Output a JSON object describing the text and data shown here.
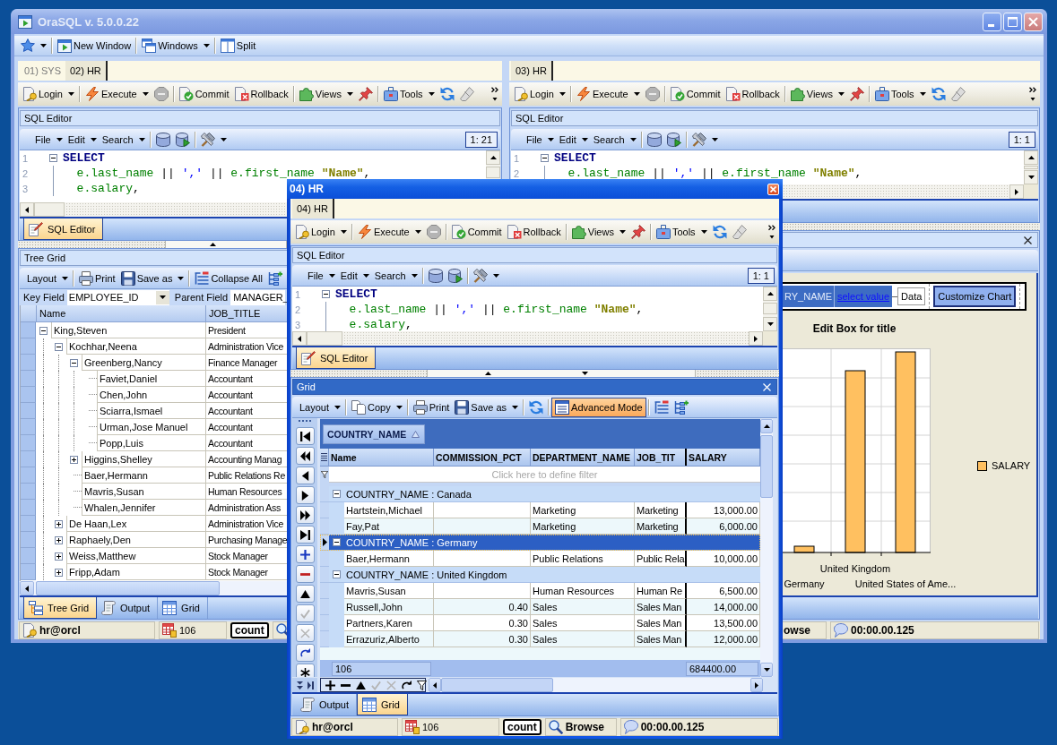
{
  "main_window": {
    "title": "OraSQL v. 5.0.0.22",
    "toolbar": [
      {
        "kind": "icon-menu"
      },
      {
        "kind": "separator"
      },
      {
        "kind": "button",
        "label": "New Window"
      },
      {
        "kind": "separator"
      },
      {
        "kind": "menu",
        "label": "Windows"
      },
      {
        "kind": "separator"
      },
      {
        "kind": "button",
        "label": "Split"
      }
    ],
    "panes": [
      {
        "tabs": [
          {
            "label": "01) SYS",
            "selected": false
          },
          {
            "label": "02) HR",
            "selected": true
          }
        ],
        "toolbar": [
          {
            "kind": "menu",
            "label": "Login"
          },
          {
            "kind": "separator"
          },
          {
            "kind": "menu",
            "label": "Execute"
          },
          {
            "kind": "icon"
          },
          {
            "kind": "separator"
          },
          {
            "kind": "button",
            "label": "Commit"
          },
          {
            "kind": "button",
            "label": "Rollback"
          },
          {
            "kind": "separator"
          },
          {
            "kind": "menu",
            "label": "Views"
          },
          {
            "kind": "icon"
          },
          {
            "kind": "separator"
          },
          {
            "kind": "menu",
            "label": "Tools"
          },
          {
            "kind": "icon"
          },
          {
            "kind": "icon"
          },
          {
            "kind": "overflow"
          }
        ],
        "editor": {
          "title": "SQL Editor",
          "toolbar": [
            {
              "kind": "menu",
              "label": "File"
            },
            {
              "kind": "menu",
              "label": "Edit"
            },
            {
              "kind": "menu",
              "label": "Search"
            },
            {
              "kind": "separator"
            },
            {
              "kind": "icon"
            },
            {
              "kind": "icon"
            },
            {
              "kind": "separator"
            },
            {
              "kind": "icon-menu"
            }
          ],
          "position": "1: 21",
          "lines": [
            {
              "number": "1",
              "fold": true,
              "indented": false,
              "tokens": [
                {
                  "kind": "keyword",
                  "text": "SELECT"
                }
              ]
            },
            {
              "number": "2",
              "fold": false,
              "indented": true,
              "tokens": [
                {
                  "kind": "ident",
                  "text": "e.last_name"
                },
                {
                  "kind": "op",
                  "text": "||"
                },
                {
                  "kind": "string",
                  "text": "','"
                },
                {
                  "kind": "op",
                  "text": "||"
                },
                {
                  "kind": "ident",
                  "text": "e.first_name"
                },
                {
                  "kind": "alias",
                  "text": "\"Name\""
                },
                {
                  "kind": "punct",
                  "text": ","
                }
              ]
            },
            {
              "number": "3",
              "fold": false,
              "indented": true,
              "tokens": [
                {
                  "kind": "ident",
                  "text": "e.salary"
                },
                {
                  "kind": "punct",
                  "text": ","
                }
              ]
            }
          ],
          "tabs": [
            {
              "label": "SQL Editor",
              "selected": true
            }
          ]
        },
        "tree_grid": {
          "title": "Tree Grid",
          "toolbar": [
            {
              "kind": "menu",
              "label": "Layout"
            },
            {
              "kind": "separator"
            },
            {
              "kind": "button",
              "label": "Print"
            },
            {
              "kind": "menu",
              "label": "Save as"
            },
            {
              "kind": "separator"
            },
            {
              "kind": "button",
              "label": "Collapse All"
            },
            {
              "kind": "icon"
            }
          ],
          "key_field": {
            "label": "Key Field",
            "value": "EMPLOYEE_ID"
          },
          "parent_field": {
            "label": "Parent Field",
            "value": "MANAGER_"
          },
          "columns": [
            "Name",
            "JOB_TITLE"
          ],
          "rows": [
            {
              "name": "King,Steven",
              "job": "President",
              "expanded": true,
              "children": [
                {
                  "name": "Kochhar,Neena",
                  "job": "Administration Vice",
                  "expanded": true,
                  "children": [
                    {
                      "name": "Greenberg,Nancy",
                      "job": "Finance Manager",
                      "expanded": true,
                      "children": [
                        {
                          "name": "Faviet,Daniel",
                          "job": "Accountant"
                        },
                        {
                          "name": "Chen,John",
                          "job": "Accountant"
                        },
                        {
                          "name": "Sciarra,Ismael",
                          "job": "Accountant"
                        },
                        {
                          "name": "Urman,Jose Manuel",
                          "job": "Accountant"
                        },
                        {
                          "name": "Popp,Luis",
                          "job": "Accountant"
                        }
                      ]
                    },
                    {
                      "name": "Higgins,Shelley",
                      "job": "Accounting Manag",
                      "expanded": false
                    },
                    {
                      "name": "Baer,Hermann",
                      "job": "Public Relations Re"
                    },
                    {
                      "name": "Mavris,Susan",
                      "job": "Human Resources"
                    },
                    {
                      "name": "Whalen,Jennifer",
                      "job": "Administration Ass"
                    }
                  ]
                },
                {
                  "name": "De Haan,Lex",
                  "job": "Administration Vice",
                  "expanded": false
                },
                {
                  "name": "Raphaely,Den",
                  "job": "Purchasing Manage",
                  "expanded": false
                },
                {
                  "name": "Weiss,Matthew",
                  "job": "Stock Manager",
                  "expanded": false
                },
                {
                  "name": "Fripp,Adam",
                  "job": "Stock Manager",
                  "expanded": false
                }
              ]
            }
          ],
          "tabs": [
            {
              "label": "Tree Grid",
              "selected": true
            },
            {
              "label": "Output",
              "selected": false
            },
            {
              "label": "Grid",
              "selected": false
            }
          ]
        },
        "status_bar": [
          {
            "kind": "user",
            "text": "hr@orcl"
          },
          {
            "kind": "rows",
            "text": "106"
          },
          {
            "kind": "button",
            "text": "count"
          },
          {
            "kind": "mode"
          }
        ]
      },
      {
        "tabs": [
          {
            "label": "03) HR",
            "selected": true
          }
        ],
        "toolbar": [
          {
            "kind": "menu",
            "label": "Login"
          },
          {
            "kind": "separator"
          },
          {
            "kind": "menu",
            "label": "Execute"
          },
          {
            "kind": "icon"
          },
          {
            "kind": "separator"
          },
          {
            "kind": "button",
            "label": "Commit"
          },
          {
            "kind": "button",
            "label": "Rollback"
          },
          {
            "kind": "separator"
          },
          {
            "kind": "menu",
            "label": "Views"
          },
          {
            "kind": "icon"
          },
          {
            "kind": "separator"
          },
          {
            "kind": "menu",
            "label": "Tools"
          },
          {
            "kind": "icon"
          },
          {
            "kind": "icon"
          },
          {
            "kind": "overflow"
          }
        ],
        "editor": {
          "title": "SQL Editor",
          "toolbar": [
            {
              "kind": "menu",
              "label": "File"
            },
            {
              "kind": "menu",
              "label": "Edit"
            },
            {
              "kind": "menu",
              "label": "Search"
            },
            {
              "kind": "separator"
            },
            {
              "kind": "icon"
            },
            {
              "kind": "icon"
            },
            {
              "kind": "separator"
            },
            {
              "kind": "icon-menu"
            }
          ],
          "position": "1: 1",
          "lines": [
            {
              "number": "1",
              "fold": true,
              "indented": false,
              "tokens": [
                {
                  "kind": "keyword",
                  "text": "SELECT"
                }
              ]
            },
            {
              "number": "2",
              "fold": false,
              "indented": true,
              "tokens": [
                {
                  "kind": "ident",
                  "text": "e.last_name"
                },
                {
                  "kind": "op",
                  "text": "||"
                },
                {
                  "kind": "string",
                  "text": "','"
                },
                {
                  "kind": "op",
                  "text": "||"
                },
                {
                  "kind": "ident",
                  "text": "e.first_name"
                },
                {
                  "kind": "alias",
                  "text": "\"Name\""
                },
                {
                  "kind": "punct",
                  "text": ","
                }
              ]
            }
          ]
        },
        "chart_panel": {
          "toolbar": [
            {
              "kind": "field",
              "text": "RY_NAME"
            },
            {
              "kind": "link",
              "text": "select value"
            },
            {
              "kind": "drop",
              "text": "Data"
            },
            {
              "kind": "button",
              "text": "Customize Chart"
            }
          ],
          "title": "Edit Box for title",
          "x_labels": [
            "Germany",
            "United Kingdom",
            "United States of Ame..."
          ],
          "legend": [
            "SALARY"
          ]
        },
        "status_bar": [
          {
            "kind": "text",
            "text": "owse"
          },
          {
            "kind": "time",
            "text": "00:00.00.125"
          }
        ]
      }
    ]
  },
  "floating_window": {
    "title": "04) HR",
    "tabs": [
      {
        "label": "04) HR",
        "selected": true
      }
    ],
    "toolbar": [
      {
        "kind": "menu",
        "label": "Login"
      },
      {
        "kind": "separator"
      },
      {
        "kind": "menu",
        "label": "Execute"
      },
      {
        "kind": "icon"
      },
      {
        "kind": "separator"
      },
      {
        "kind": "button",
        "label": "Commit"
      },
      {
        "kind": "button",
        "label": "Rollback"
      },
      {
        "kind": "separator"
      },
      {
        "kind": "menu",
        "label": "Views"
      },
      {
        "kind": "icon"
      },
      {
        "kind": "separator"
      },
      {
        "kind": "menu",
        "label": "Tools"
      },
      {
        "kind": "icon"
      },
      {
        "kind": "icon"
      },
      {
        "kind": "overflow"
      }
    ],
    "editor": {
      "title": "SQL Editor",
      "toolbar": [
        {
          "kind": "menu",
          "label": "File"
        },
        {
          "kind": "menu",
          "label": "Edit"
        },
        {
          "kind": "menu",
          "label": "Search"
        },
        {
          "kind": "separator"
        },
        {
          "kind": "icon"
        },
        {
          "kind": "icon"
        },
        {
          "kind": "separator"
        },
        {
          "kind": "icon-menu"
        }
      ],
      "position": "1: 1",
      "lines": [
        {
          "number": "1",
          "fold": true,
          "indented": false,
          "tokens": [
            {
              "kind": "keyword",
              "text": "SELECT"
            }
          ]
        },
        {
          "number": "2",
          "fold": false,
          "indented": true,
          "tokens": [
            {
              "kind": "ident",
              "text": "e.last_name"
            },
            {
              "kind": "op",
              "text": "||"
            },
            {
              "kind": "string",
              "text": "','"
            },
            {
              "kind": "op",
              "text": "||"
            },
            {
              "kind": "ident",
              "text": "e.first_name"
            },
            {
              "kind": "alias",
              "text": "\"Name\""
            },
            {
              "kind": "punct",
              "text": ","
            }
          ]
        },
        {
          "number": "3",
          "fold": false,
          "indented": true,
          "tokens": [
            {
              "kind": "ident",
              "text": "e.salary"
            },
            {
              "kind": "punct",
              "text": ","
            }
          ]
        }
      ],
      "tabs": [
        {
          "label": "SQL Editor",
          "selected": true
        }
      ]
    },
    "grid": {
      "title": "Grid",
      "toolbar": [
        {
          "kind": "menu",
          "label": "Layout"
        },
        {
          "kind": "separator"
        },
        {
          "kind": "menu",
          "label": "Copy"
        },
        {
          "kind": "separator"
        },
        {
          "kind": "button",
          "label": "Print"
        },
        {
          "kind": "menu",
          "label": "Save as"
        },
        {
          "kind": "separator"
        },
        {
          "kind": "icon"
        },
        {
          "kind": "separator"
        },
        {
          "kind": "toggle",
          "label": "Advanced Mode",
          "pressed": true
        },
        {
          "kind": "separator"
        },
        {
          "kind": "icon"
        },
        {
          "kind": "icon"
        }
      ],
      "navigator": [
        {
          "disabled": false
        },
        {
          "disabled": false
        },
        {
          "disabled": false
        },
        {
          "disabled": false
        },
        {
          "disabled": false
        },
        {
          "disabled": false
        },
        {
          "disabled": false
        },
        {
          "disabled": false
        },
        {
          "disabled": false
        },
        {
          "disabled": true
        },
        {
          "disabled": true
        },
        {
          "disabled": false
        },
        {
          "disabled": false
        }
      ],
      "group_by": [
        "COUNTRY_NAME"
      ],
      "columns": [
        "Name",
        "COMMISSION_PCT",
        "DEPARTMENT_NAME",
        "JOB_TIT",
        "SALARY"
      ],
      "filter_row": {
        "placeholder": "Click here to define filter"
      },
      "groups": [
        {
          "label": "COUNTRY_NAME : Canada",
          "expanded": true,
          "selected": false,
          "rows": [
            {
              "name": "Hartstein,Michael",
              "department_name": "Marketing",
              "column_4": "Marketing",
              "salary": "13,000.00",
              "selected": false
            },
            {
              "name": "Fay,Pat",
              "department_name": "Marketing",
              "column_4": "Marketing",
              "salary": "6,000.00",
              "selected": false
            }
          ]
        },
        {
          "label": "COUNTRY_NAME : Germany",
          "expanded": true,
          "selected": true,
          "rows": [
            {
              "name": "Baer,Hermann",
              "department_name": "Public Relations",
              "column_4": "Public Rela",
              "salary": "10,000.00",
              "selected": false
            }
          ]
        },
        {
          "label": "COUNTRY_NAME : United Kingdom",
          "expanded": true,
          "selected": false,
          "rows": [
            {
              "name": "Mavris,Susan",
              "department_name": "Human Resources",
              "column_4": "Human Re",
              "salary": "6,500.00",
              "selected": false
            },
            {
              "name": "Russell,John",
              "commission_pct": "0.40",
              "department_name": "Sales",
              "column_4": "Sales Man",
              "salary": "14,000.00",
              "selected": false
            },
            {
              "name": "Partners,Karen",
              "commission_pct": "0.30",
              "department_name": "Sales",
              "column_4": "Sales Man",
              "salary": "13,500.00",
              "selected": false
            },
            {
              "name": "Errazuriz,Alberto",
              "commission_pct": "0.30",
              "department_name": "Sales",
              "column_4": "Sales Man",
              "salary": "12,000.00",
              "selected": false
            }
          ]
        }
      ],
      "footer": {
        "count": "106",
        "sum": "684400.00"
      },
      "mini_navigator": [
        {
          "disabled": false
        },
        {
          "disabled": false
        },
        {
          "disabled": false
        },
        {
          "disabled": true
        },
        {
          "disabled": true
        },
        {
          "disabled": false
        },
        {
          "disabled": false
        }
      ],
      "tabs": [
        {
          "label": "Output",
          "selected": false
        },
        {
          "label": "Grid",
          "selected": true
        }
      ]
    },
    "status_bar": [
      {
        "kind": "user",
        "text": "hr@orcl"
      },
      {
        "kind": "rows",
        "text": "106"
      },
      {
        "kind": "button",
        "text": "count"
      },
      {
        "kind": "mode",
        "text": "Browse"
      },
      {
        "kind": "time",
        "text": "00:00.00.125"
      }
    ]
  }
}
